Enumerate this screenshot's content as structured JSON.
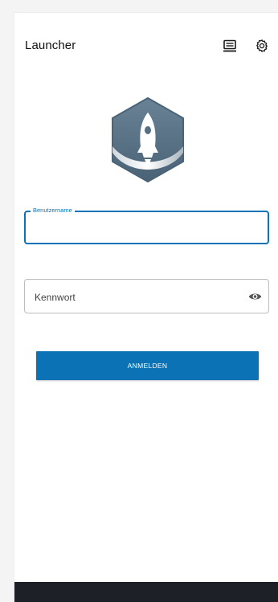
{
  "app": {
    "title": "Launcher"
  },
  "toolbar": {
    "icons": [
      "screen-icon",
      "gear-icon"
    ]
  },
  "logo": {
    "name": "rocket-logo",
    "colors": {
      "hexagon": "#566f82",
      "rocket": "#ffffff",
      "swoosh": "#b8c3cb"
    }
  },
  "form": {
    "username": {
      "label": "Benutzername",
      "value": ""
    },
    "password": {
      "placeholder": "Kennwort",
      "value": "",
      "toggle_icon": "eye-icon"
    },
    "submit_label": "ANMELDEN"
  },
  "colors": {
    "accent": "#0b72b6",
    "bottom_bar": "#1d2026",
    "background": "#ffffff"
  }
}
